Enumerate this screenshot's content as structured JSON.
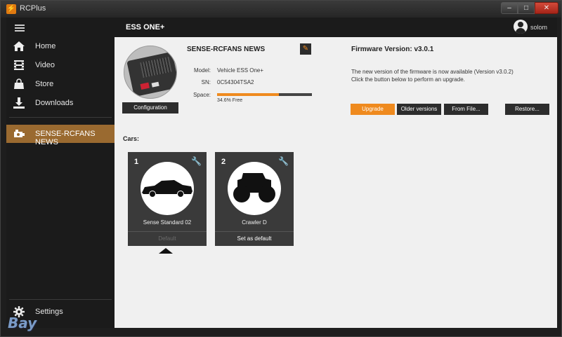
{
  "window": {
    "title": "RCPlus",
    "app_icon": "lightning-icon",
    "controls": {
      "minimize": "–",
      "maximize": "□",
      "close": "✕"
    }
  },
  "header": {
    "product": "ESS ONE+",
    "user": "solom"
  },
  "sidebar": {
    "items": [
      {
        "label": "Home",
        "icon": "home-icon"
      },
      {
        "label": "Video",
        "icon": "film-icon"
      },
      {
        "label": "Store",
        "icon": "bag-icon"
      },
      {
        "label": "Downloads",
        "icon": "download-icon"
      },
      {
        "label": "SENSE-RCFANS NEWS",
        "icon": "car-icon",
        "active": true
      }
    ],
    "settings_label": "Settings"
  },
  "device": {
    "name": "SENSE-RCFANS NEWS",
    "configuration_button": "Configuration",
    "model_label": "Model:",
    "model": "Vehicle ESS One+",
    "sn_label": "SN:",
    "sn": "0C54304TSA2",
    "space_label": "Space:",
    "space_used_fraction": 0.654,
    "space_free": "34.6% Free"
  },
  "firmware": {
    "title": "Firmware Version: v3.0.1",
    "message_1": "The new version of the firmware is now available (Version v3.0.2)",
    "message_2": "Click the button below to perform an upgrade.",
    "upgrade_button": "Upgrade",
    "older_button": "Older versions",
    "from_file_button": "From File...",
    "restore_button": "Restore..."
  },
  "cars": {
    "label": "Cars:",
    "items": [
      {
        "number": "1",
        "name": "Sense Standard 02",
        "default_label": "Default",
        "is_default": true
      },
      {
        "number": "2",
        "name": "Crawler D",
        "default_label": "Set as default",
        "is_default": false
      }
    ]
  },
  "watermark": "Bay",
  "colors": {
    "accent": "#ef8a1e",
    "active_nav": "#9a6a30",
    "sidebar": "#1b1b1b",
    "card": "#3a3a3a"
  }
}
